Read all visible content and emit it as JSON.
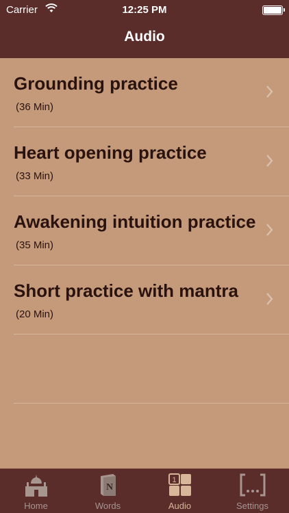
{
  "status": {
    "carrier": "Carrier",
    "time": "12:25 PM"
  },
  "nav": {
    "title": "Audio"
  },
  "items": [
    {
      "title": "Grounding practice",
      "duration": "(36 Min)"
    },
    {
      "title": "Heart opening practice",
      "duration": "(33 Min)"
    },
    {
      "title": "Awakening intuition practice",
      "duration": "(35 Min)"
    },
    {
      "title": "Short practice with mantra",
      "duration": "(20 Min)"
    }
  ],
  "tabs": [
    {
      "label": "Home",
      "icon": "temple-icon"
    },
    {
      "label": "Words",
      "icon": "book-icon"
    },
    {
      "label": "Audio",
      "icon": "audio-grid-icon",
      "active": true
    },
    {
      "label": "Settings",
      "icon": "settings-bracket-icon"
    }
  ],
  "colors": {
    "bar": "#5a2d2a",
    "background": "#c49a7a",
    "text": "#2a120e",
    "active": "#d8b69a"
  }
}
